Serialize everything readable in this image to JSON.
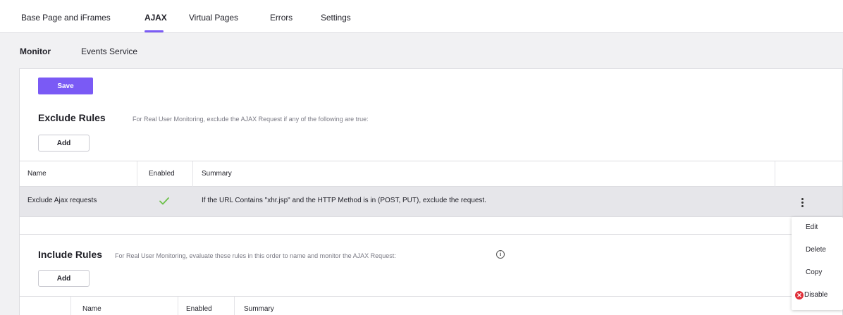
{
  "top_tabs": [
    "Base Page and iFrames",
    "AJAX",
    "Virtual Pages",
    "Errors",
    "Settings"
  ],
  "active_top_tab": "AJAX",
  "sub_tabs": [
    "Monitor",
    "Events Service"
  ],
  "active_sub_tab": "Monitor",
  "save_label": "Save",
  "exclude": {
    "title": "Exclude Rules",
    "description": "For Real User Monitoring, exclude the AJAX Request if any of the following are true:",
    "add_label": "Add",
    "columns": {
      "name": "Name",
      "enabled": "Enabled",
      "summary": "Summary"
    },
    "rows": [
      {
        "name": "Exclude Ajax requests",
        "enabled": true,
        "summary": "If the URL Contains \"xhr.jsp\" and the HTTP Method is in (POST, PUT), exclude the request."
      }
    ]
  },
  "include": {
    "title": "Include Rules",
    "description": "For Real User Monitoring, evaluate these rules in this order to name and monitor the AJAX Request:",
    "info_icon": "info-icon",
    "add_label": "Add",
    "columns": {
      "name": "Name",
      "enabled": "Enabled",
      "summary": "Summary"
    }
  },
  "context_menu": {
    "items": [
      "Edit",
      "Delete",
      "Copy",
      "Disable"
    ],
    "disable_icon": "close-circle-icon",
    "disable_color": "#e0303a"
  },
  "colors": {
    "accent": "#7a5af5",
    "check": "#6cc04a",
    "row_selected": "#e6e6ea"
  }
}
